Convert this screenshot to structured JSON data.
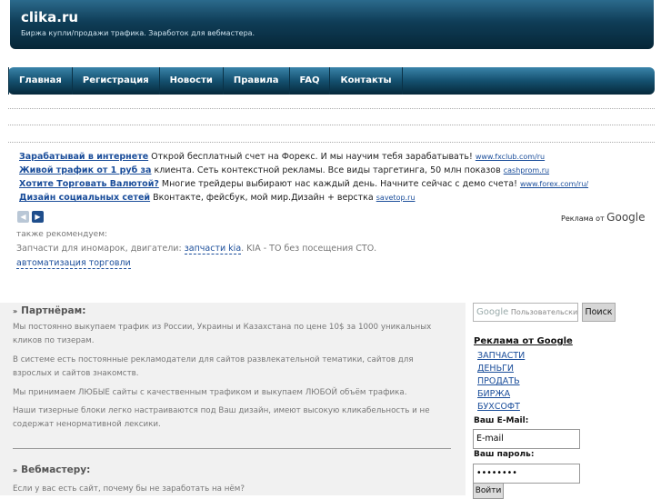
{
  "header": {
    "title": "clika.ru",
    "slogan": "Биржа купли/продажи трафика. Заработок для вебмастера."
  },
  "nav": [
    "Главная",
    "Регистрация",
    "Новости",
    "Правила",
    "FAQ",
    "Контакты"
  ],
  "ads": [
    {
      "title": "Зарабатывай в интернете",
      "text": " Открой бесплатный счет на Форекс. И мы научим тебя зарабатывать! ",
      "url": "www.fxclub.com/ru"
    },
    {
      "title": "Живой трафик от 1 руб за",
      "text": " клиента. Сеть контекстной рекламы. Все виды таргетинга, 50 млн показов ",
      "url": "cashprom.ru"
    },
    {
      "title": "Хотите Торговать Валютой?",
      "text": " Многие трейдеры выбирают нас каждый день. Начните сейчас с демо счета! ",
      "url": "www.forex.com/ru/"
    },
    {
      "title": "Дизайн социальных сетей",
      "text": " Вконтакте, фейсбук, мой мир.Дизайн + верстка ",
      "url": "savetop.ru"
    }
  ],
  "ads_by": {
    "prefix": "Реклама от ",
    "brand": "Google"
  },
  "recommend": {
    "label": "также рекомендуем:",
    "text_before": "Запчасти для иномарок, двигатели: ",
    "link1": "запчасти kia",
    "text_after": ". KIA - ТО без посещения СТО.",
    "link2": "автоматизация торговли"
  },
  "partners": {
    "heading": "Партнёрам:",
    "paragraphs": [
      "Мы постоянно выкупаем трафик из России, Украины и Казахстана по цене 10$ за 1000 уникальных кликов по тизерам.",
      "В системе есть постоянные рекламодатели для сайтов развлекательной тематики, сайтов для взрослых и сайтов знакомств.",
      "Мы принимаем ЛЮБЫЕ сайты с качественным трафиком и выкупаем ЛЮБОЙ объём трафика.",
      "Наши тизерные блоки легко настраиваются под Ваш дизайн, имеют высокую кликабельность и не содержат ненормативной лексики."
    ]
  },
  "webmaster": {
    "heading": "Вебмастеру:",
    "paragraph": "Если у вас есть сайт, почему бы не заработать на нём?"
  },
  "sidebar": {
    "search_brand": "Google",
    "search_placeholder": "Пользовательский поиск",
    "search_button": "Поиск",
    "ads_title": "Реклама от Google",
    "ad_links": [
      "ЗАПЧАСТИ",
      "ДЕНЬГИ",
      "ПРОДАТЬ",
      "БИРЖА",
      "БУХСОФТ"
    ],
    "email_label": "Ваш E-Mail:",
    "email_value": "E-mail",
    "password_label": "Ваш пароль:",
    "password_value": "••••••••",
    "login_button": "Войти"
  }
}
